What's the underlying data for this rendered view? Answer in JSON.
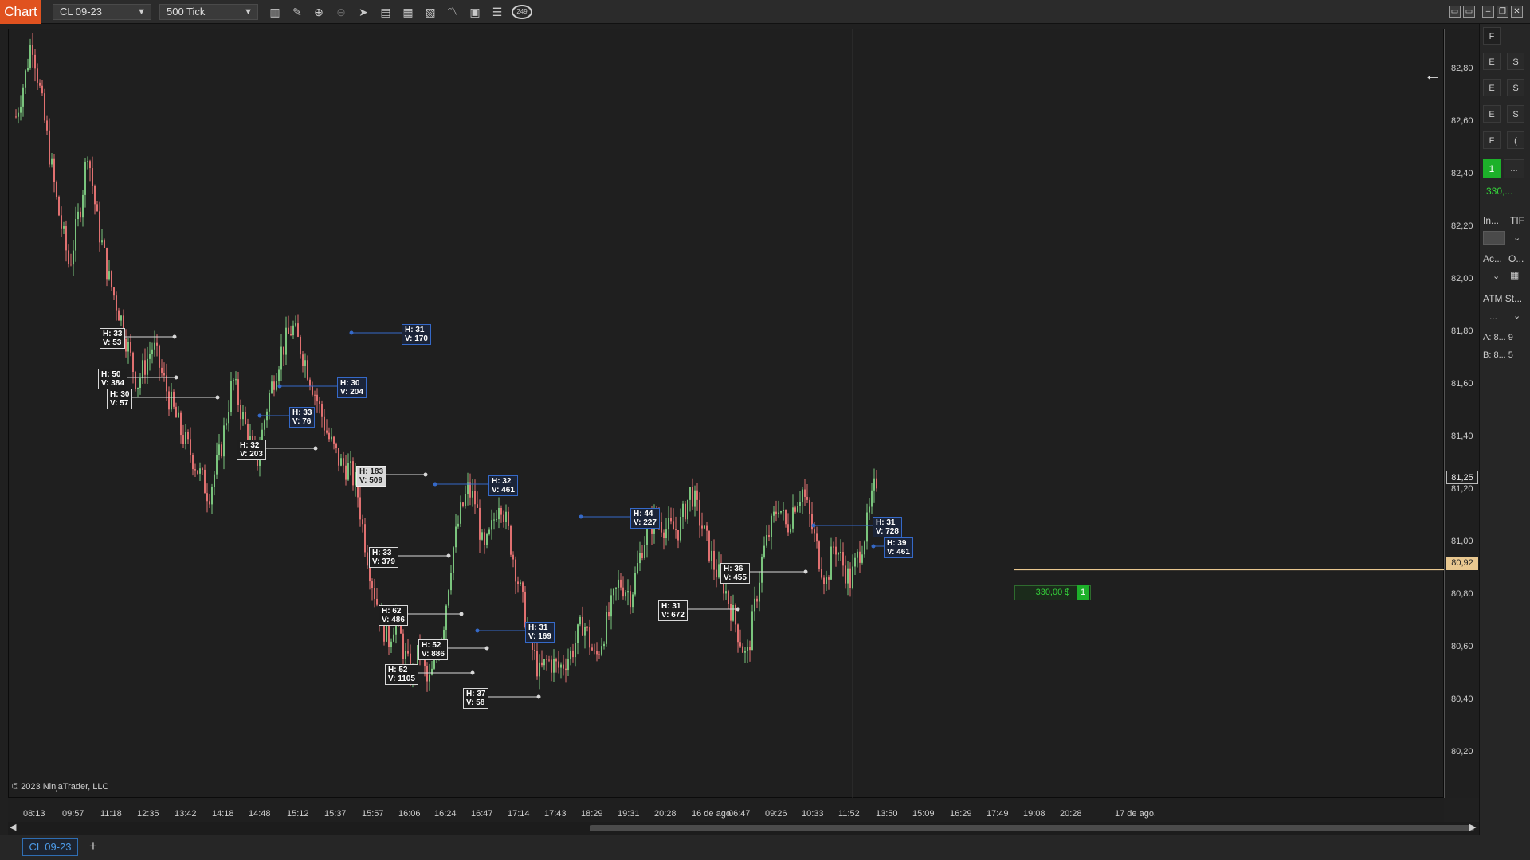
{
  "toolbar": {
    "chart_tab": "Chart",
    "instrument": "CL 09-23",
    "interval": "500 Tick",
    "clock_label": "249"
  },
  "price_axis": {
    "labels": [
      "82,80",
      "82,60",
      "82,40",
      "82,20",
      "82,00",
      "81,80",
      "81,60",
      "81,40",
      "81,20",
      "81,00",
      "80,80",
      "80,60",
      "80,40",
      "80,20"
    ],
    "last_price": "81,25",
    "position_price": "80,92"
  },
  "time_axis": {
    "labels": [
      "08:13",
      "09:57",
      "11:18",
      "12:35",
      "13:42",
      "14:18",
      "14:48",
      "15:12",
      "15:37",
      "15:57",
      "16:06",
      "16:24",
      "16:47",
      "17:14",
      "17:43",
      "18:29",
      "19:31",
      "20:28",
      "16 de ago.",
      "06:47",
      "09:26",
      "10:33",
      "11:52",
      "13:50",
      "15:09",
      "16:29",
      "17:49",
      "19:08",
      "20:28",
      "17 de ago."
    ]
  },
  "copyright": "© 2023 NinjaTrader, LLC",
  "position": {
    "pnl": "330,00 $",
    "qty": "1"
  },
  "annotations": [
    {
      "h": "H: 33",
      "v": "V: 53",
      "style": "w"
    },
    {
      "h": "H: 50",
      "v": "V: 384",
      "style": "w"
    },
    {
      "h": "H: 30",
      "v": "V: 57",
      "style": "w"
    },
    {
      "h": "H: 32",
      "v": "V: 203",
      "style": "w"
    },
    {
      "h": "H: 31",
      "v": "V: 170",
      "style": "b"
    },
    {
      "h": "H: 30",
      "v": "V: 204",
      "style": "b"
    },
    {
      "h": "H: 33",
      "v": "V: 76",
      "style": "b"
    },
    {
      "h": "H: 183",
      "v": "V: 509",
      "style": "wf"
    },
    {
      "h": "H: 33",
      "v": "V: 379",
      "style": "w"
    },
    {
      "h": "H: 62",
      "v": "V: 486",
      "style": "w"
    },
    {
      "h": "H: 52",
      "v": "V: 886",
      "style": "w"
    },
    {
      "h": "H: 52",
      "v": "V: 1105",
      "style": "w"
    },
    {
      "h": "H: 31",
      "v": "V: 169",
      "style": "b"
    },
    {
      "h": "H: 44",
      "v": "V: 227",
      "style": "b"
    },
    {
      "h": "H: 31",
      "v": "V: 672",
      "style": "w"
    },
    {
      "h": "H: 36",
      "v": "V: 455",
      "style": "w"
    },
    {
      "h": "H: 31",
      "v": "V: 728",
      "style": "b"
    },
    {
      "h": "H: 39",
      "v": "V: 461",
      "style": "b"
    },
    {
      "h": "H: 32",
      "v": "V: 461",
      "style": "b"
    },
    {
      "h": "H: 37",
      "v": "V: 58",
      "style": "w"
    }
  ],
  "right_panel": {
    "btn_labels": [
      "E",
      "S",
      "E",
      "S",
      "E",
      "S",
      "F",
      "("
    ],
    "qty": "1",
    "more": "...",
    "pnl": "330,...",
    "instrument_short": "In...",
    "tif": "TIF",
    "account_short": "Ac...",
    "other_short": "O...",
    "atm": "ATM St...",
    "atm_value": "...",
    "ask": "A:  8...  9",
    "bid": "B:  8...  5"
  },
  "bottom": {
    "tab": "CL 09-23",
    "add": "+"
  },
  "colors": {
    "up": "#7ac47d",
    "down": "#e07070",
    "accent": "#e0521f",
    "position_line": "#e9c890"
  }
}
